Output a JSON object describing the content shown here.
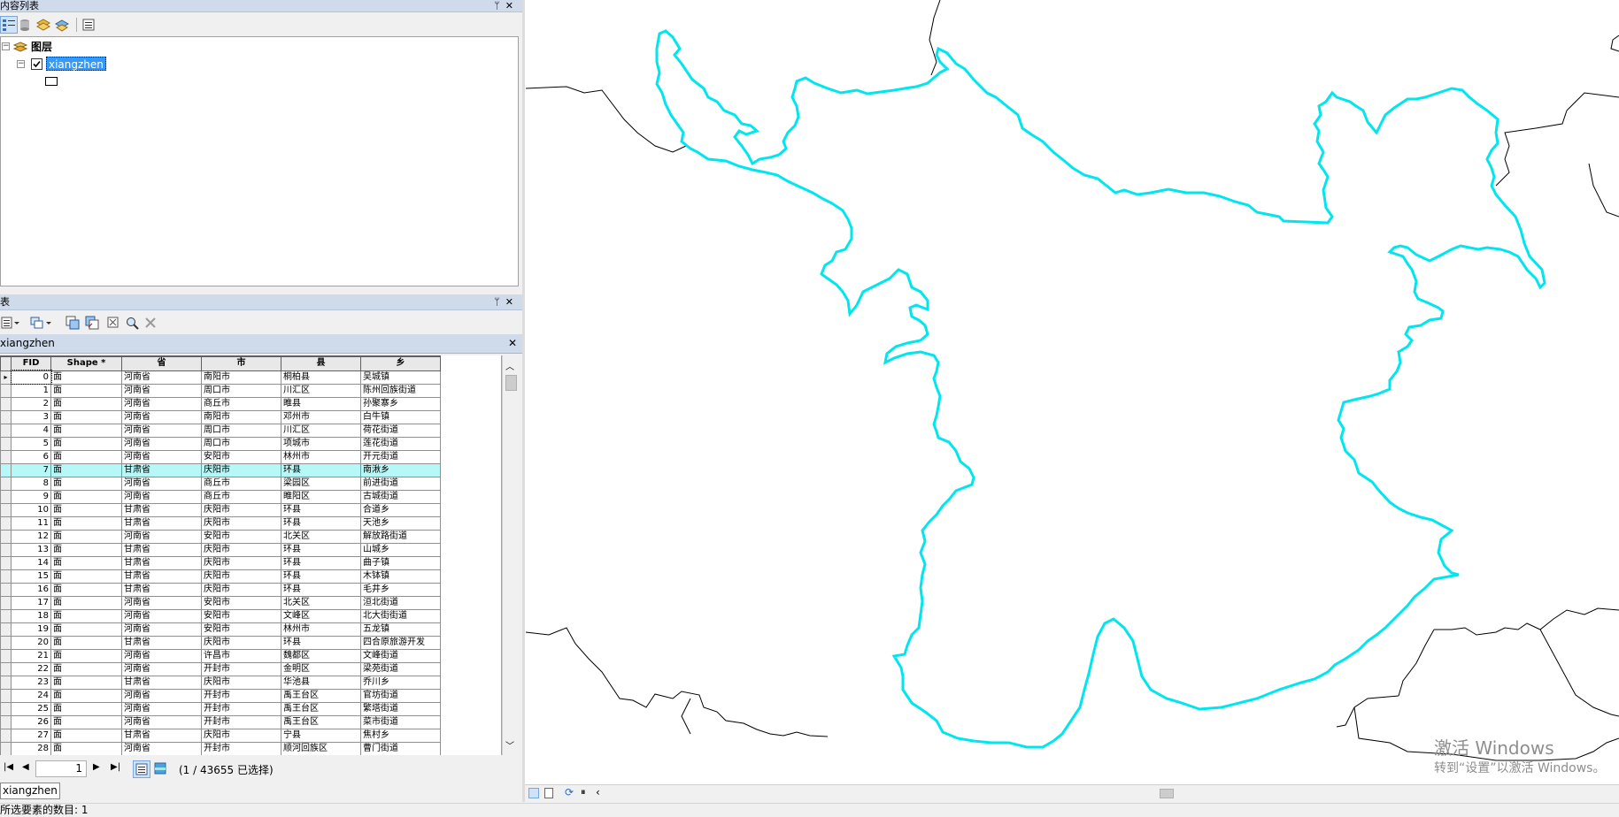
{
  "toc": {
    "title": "内容列表",
    "root_label": "图层",
    "layer_name": "xiangzhen"
  },
  "table_window": {
    "title": "表",
    "tab_label": "xiangzhen",
    "columns": [
      "FID",
      "Shape *",
      "省",
      "市",
      "县",
      "乡"
    ],
    "selected_row": 7,
    "rows": [
      [
        "0",
        "面",
        "河南省",
        "南阳市",
        "桐柏县",
        "吴城镇"
      ],
      [
        "1",
        "面",
        "河南省",
        "周口市",
        "川汇区",
        "陈州回族街道"
      ],
      [
        "2",
        "面",
        "河南省",
        "商丘市",
        "睢县",
        "孙聚寨乡"
      ],
      [
        "3",
        "面",
        "河南省",
        "南阳市",
        "邓州市",
        "白牛镇"
      ],
      [
        "4",
        "面",
        "河南省",
        "周口市",
        "川汇区",
        "荷花街道"
      ],
      [
        "5",
        "面",
        "河南省",
        "周口市",
        "项城市",
        "莲花街道"
      ],
      [
        "6",
        "面",
        "河南省",
        "安阳市",
        "林州市",
        "开元街道"
      ],
      [
        "7",
        "面",
        "甘肃省",
        "庆阳市",
        "环县",
        "南湫乡"
      ],
      [
        "8",
        "面",
        "河南省",
        "商丘市",
        "梁园区",
        "前进街道"
      ],
      [
        "9",
        "面",
        "河南省",
        "商丘市",
        "睢阳区",
        "古城街道"
      ],
      [
        "10",
        "面",
        "甘肃省",
        "庆阳市",
        "环县",
        "合道乡"
      ],
      [
        "11",
        "面",
        "甘肃省",
        "庆阳市",
        "环县",
        "天池乡"
      ],
      [
        "12",
        "面",
        "河南省",
        "安阳市",
        "北关区",
        "解放路街道"
      ],
      [
        "13",
        "面",
        "甘肃省",
        "庆阳市",
        "环县",
        "山城乡"
      ],
      [
        "14",
        "面",
        "甘肃省",
        "庆阳市",
        "环县",
        "曲子镇"
      ],
      [
        "15",
        "面",
        "甘肃省",
        "庆阳市",
        "环县",
        "木钵镇"
      ],
      [
        "16",
        "面",
        "甘肃省",
        "庆阳市",
        "环县",
        "毛井乡"
      ],
      [
        "17",
        "面",
        "河南省",
        "安阳市",
        "北关区",
        "洹北街道"
      ],
      [
        "18",
        "面",
        "河南省",
        "安阳市",
        "文峰区",
        "北大街街道"
      ],
      [
        "19",
        "面",
        "河南省",
        "安阳市",
        "林州市",
        "五龙镇"
      ],
      [
        "20",
        "面",
        "甘肃省",
        "庆阳市",
        "环县",
        "四合原旅游开发"
      ],
      [
        "21",
        "面",
        "河南省",
        "许昌市",
        "魏都区",
        "文峰街道"
      ],
      [
        "22",
        "面",
        "河南省",
        "开封市",
        "金明区",
        "梁苑街道"
      ],
      [
        "23",
        "面",
        "甘肃省",
        "庆阳市",
        "华池县",
        "乔川乡"
      ],
      [
        "24",
        "面",
        "河南省",
        "开封市",
        "禹王台区",
        "官坊街道"
      ],
      [
        "25",
        "面",
        "河南省",
        "开封市",
        "禹王台区",
        "繁塔街道"
      ],
      [
        "26",
        "面",
        "河南省",
        "开封市",
        "禹王台区",
        "菜市街道"
      ],
      [
        "27",
        "面",
        "甘肃省",
        "庆阳市",
        "宁县",
        "焦村乡"
      ],
      [
        "28",
        "面",
        "河南省",
        "开封市",
        "顺河回族区",
        "曹门街道"
      ]
    ]
  },
  "navigation": {
    "current_record": "1",
    "selection_info": "(1 / 43655 已选择)"
  },
  "layer_tab": "xiangzhen",
  "status_bar": "所选要素的数目: 1",
  "watermark": {
    "line1": "激活 Windows",
    "line2": "转到“设置”以激活 Windows。"
  },
  "colors": {
    "selection_outline": "#00e6ee",
    "selected_row": "#b6f7f7",
    "layer_highlight": "#3399ff"
  }
}
